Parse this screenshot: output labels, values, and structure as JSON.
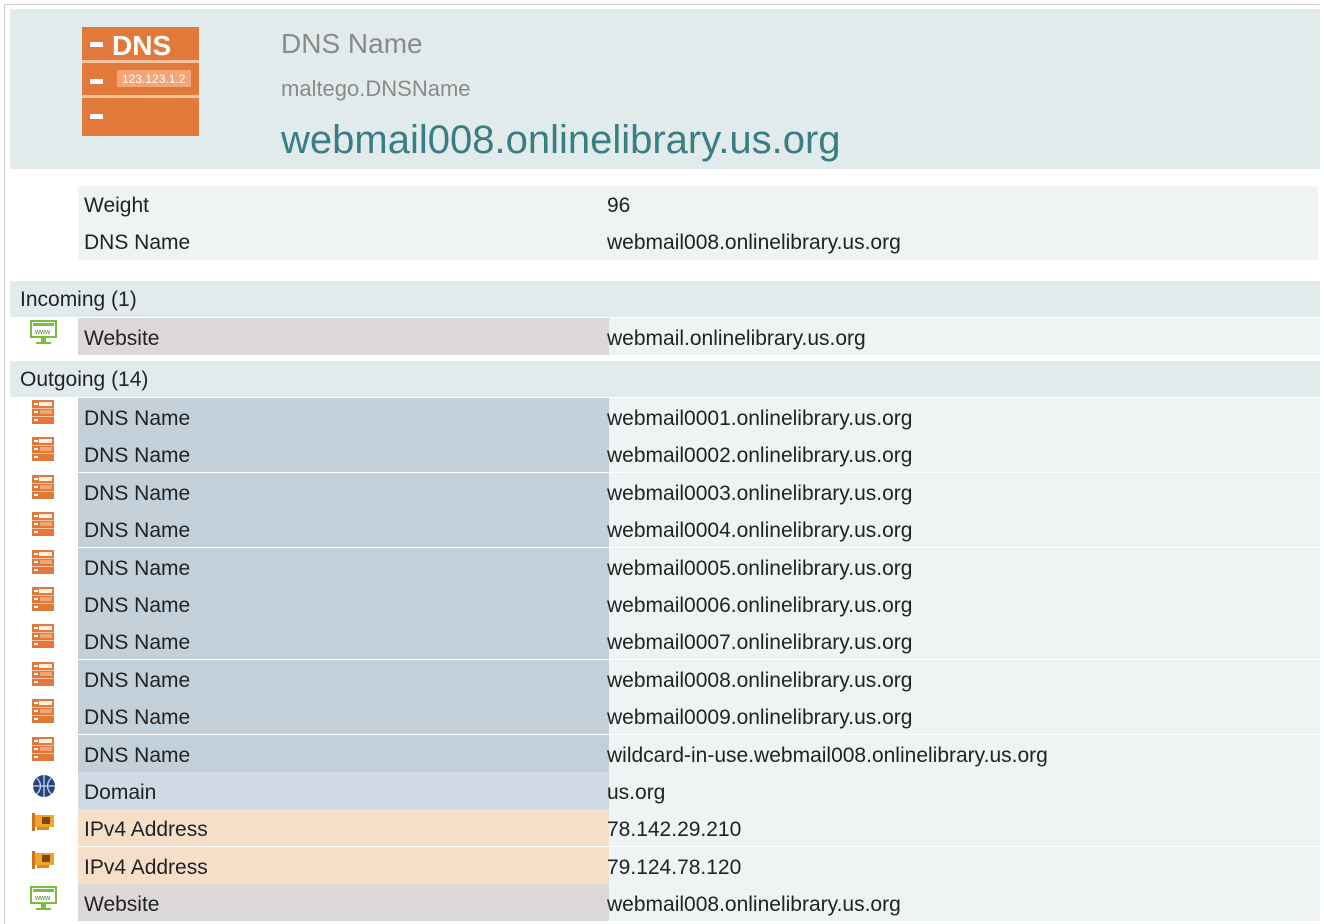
{
  "entity": {
    "type_label": "DNS Name",
    "type_id": "maltego.DNSName",
    "value": "webmail008.onlinelibrary.us.org",
    "icon": "dns-server-icon",
    "icon_text_top": "DNS",
    "icon_text_ip": "123.123.1.2"
  },
  "properties": [
    {
      "key": "Weight",
      "value": "96"
    },
    {
      "key": "DNS Name",
      "value": "webmail008.onlinelibrary.us.org"
    }
  ],
  "incoming": {
    "title": "Incoming (1)",
    "items": [
      {
        "type": "Website",
        "value": "webmail.onlinelibrary.us.org",
        "icon": "website-icon"
      }
    ]
  },
  "outgoing": {
    "title": "Outgoing (14)",
    "items": [
      {
        "type": "DNS Name",
        "value": "webmail0001.onlinelibrary.us.org",
        "icon": "dns-icon"
      },
      {
        "type": "DNS Name",
        "value": "webmail0002.onlinelibrary.us.org",
        "icon": "dns-icon"
      },
      {
        "type": "DNS Name",
        "value": "webmail0003.onlinelibrary.us.org",
        "icon": "dns-icon"
      },
      {
        "type": "DNS Name",
        "value": "webmail0004.onlinelibrary.us.org",
        "icon": "dns-icon"
      },
      {
        "type": "DNS Name",
        "value": "webmail0005.onlinelibrary.us.org",
        "icon": "dns-icon"
      },
      {
        "type": "DNS Name",
        "value": "webmail0006.onlinelibrary.us.org",
        "icon": "dns-icon"
      },
      {
        "type": "DNS Name",
        "value": "webmail0007.onlinelibrary.us.org",
        "icon": "dns-icon"
      },
      {
        "type": "DNS Name",
        "value": "webmail0008.onlinelibrary.us.org",
        "icon": "dns-icon"
      },
      {
        "type": "DNS Name",
        "value": "webmail0009.onlinelibrary.us.org",
        "icon": "dns-icon"
      },
      {
        "type": "DNS Name",
        "value": "wildcard-in-use.webmail008.onlinelibrary.us.org",
        "icon": "dns-icon"
      },
      {
        "type": "Domain",
        "value": "us.org",
        "icon": "domain-globe-icon"
      },
      {
        "type": "IPv4 Address",
        "value": "78.142.29.210",
        "icon": "ipv4-network-card-icon"
      },
      {
        "type": "IPv4 Address",
        "value": "79.124.78.120",
        "icon": "ipv4-network-card-icon"
      },
      {
        "type": "Website",
        "value": "webmail008.onlinelibrary.us.org",
        "icon": "website-icon"
      }
    ]
  },
  "colors": {
    "header_bg": "#e2ebeb",
    "title_teal": "#3a7d84",
    "dns_orange": "#e0793a",
    "dns_row": "#c3cfd9",
    "domain_row": "#d0dae4",
    "ipv4_row": "#f6dfc8",
    "website_row": "#ddd8d8",
    "value_bg": "#eef3f3"
  }
}
